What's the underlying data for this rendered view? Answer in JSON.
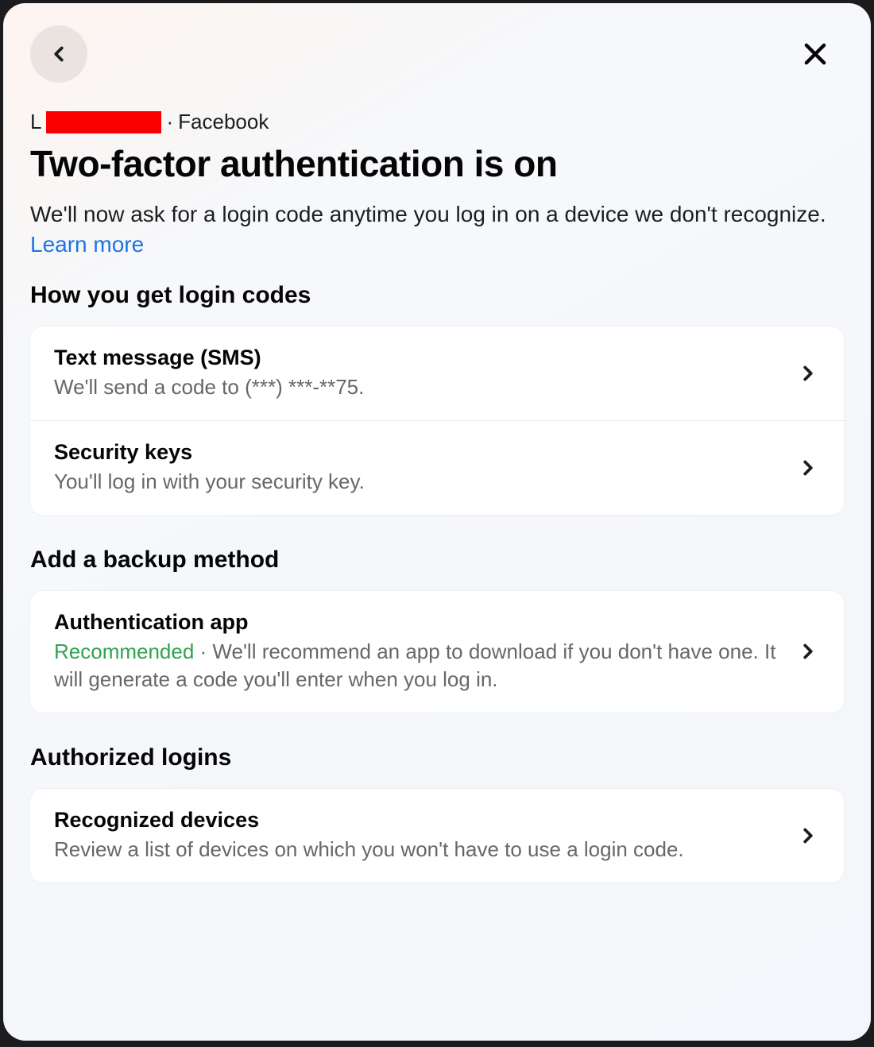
{
  "breadcrumb": {
    "prefix": "L",
    "separator": "·",
    "platform": "Facebook"
  },
  "title": "Two-factor authentication is on",
  "description": "We'll now ask for a login code anytime you log in on a device we don't recognize. ",
  "learn_more": "Learn more",
  "sections": {
    "login_codes_heading": "How you get login codes",
    "backup_heading": "Add a backup method",
    "authorized_heading": "Authorized logins"
  },
  "methods": {
    "sms": {
      "title": "Text message (SMS)",
      "subtitle": "We'll send a code to (***) ***-**75."
    },
    "security_keys": {
      "title": "Security keys",
      "subtitle": "You'll log in with your security key."
    },
    "auth_app": {
      "title": "Authentication app",
      "recommended_label": "Recommended",
      "separator": " · ",
      "subtitle": "We'll recommend an app to download if you don't have one. It will generate a code you'll enter when you log in."
    },
    "recognized": {
      "title": "Recognized devices",
      "subtitle": "Review a list of devices on which you won't have to use a login code."
    }
  }
}
